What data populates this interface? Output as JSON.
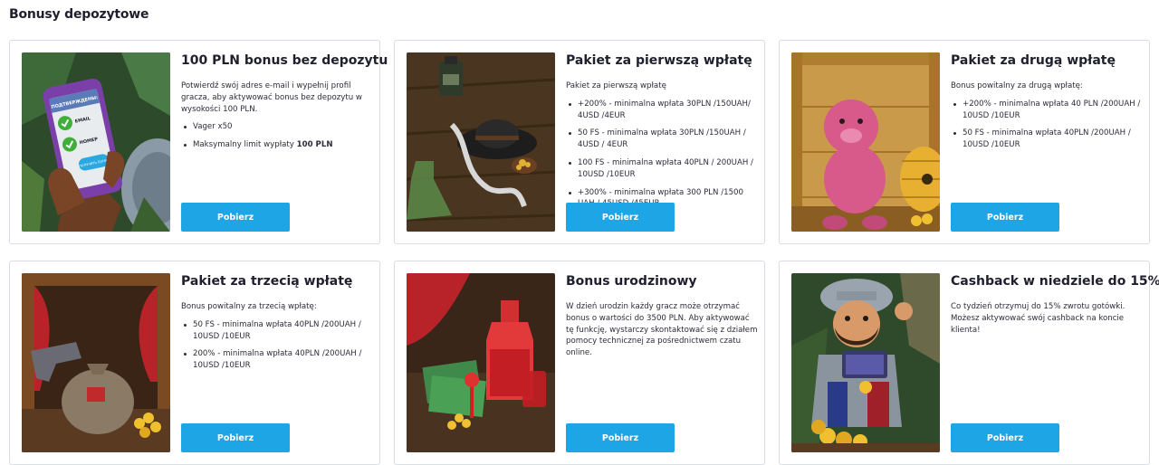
{
  "page": {
    "title": "Bonusy depozytowe"
  },
  "cards": [
    {
      "title": "100 PLN bonus bez depozytu",
      "intro": "Potwierdź swój adres e-mail i wypełnij profil gracza, aby aktywować bonus bez depozytu w wysokości 100 PLN.",
      "items": [
        "Vager x50",
        "Maksymalny limit wypłaty "
      ],
      "items_bold": [
        "",
        "100 PLN"
      ],
      "button": "Pobierz",
      "image": "phone-verification-illustration",
      "image_text": {
        "header": "ПОДТВЕРЖДЕНЫ:",
        "line1": "EMAIL",
        "line2": "НОМЕР",
        "cta": "ПОЛУЧИТЬ БОНУС"
      }
    },
    {
      "title": "Pakiet za pierwszą wpłatę",
      "intro": "Pakiet za pierwszą wpłatę",
      "items": [
        "+200% - minimalna wpłata 30PLN /150UAH/ 4USD /4EUR",
        "50 FS - minimalna wpłata 30PLN /150UAH / 4USD / 4EUR",
        "100 FS - minimalna wpłata 40PLN / 200UAH / 10USD /10EUR",
        "+300% - minimalna wpłata 300 PLN /1500 UAH / 45USD /45EUR"
      ],
      "button": "Pobierz",
      "image": "explorer-table-illustration"
    },
    {
      "title": "Pakiet za drugą wpłatę",
      "intro": "Bonus powitalny za drugą wpłatę:",
      "items": [
        "+200% - minimalna wpłata 40 PLN /200UAH / 10USD /10EUR",
        "50 FS - minimalna wpłata 40PLN /200UAH / 10USD /10EUR"
      ],
      "button": "Pobierz",
      "image": "pink-pig-beehive-illustration"
    },
    {
      "title": "Pakiet za trzecią wpłatę",
      "intro": "Bonus powitalny za trzecią wpłatę:",
      "items": [
        "50 FS - minimalna wpłata 40PLN /200UAH / 10USD /10EUR",
        "200% - minimalna wpłata 40PLN /200UAH / 10USD /10EUR"
      ],
      "button": "Pobierz",
      "image": "money-bag-revolver-illustration"
    },
    {
      "title": "Bonus urodzinowy",
      "intro": "W dzień urodzin każdy gracz może otrzymać bonus o wartości do 3500 PLN. Aby aktywować tę funkcję, wystarczy skontaktować się z działem pomocy technicznej za pośrednictwem czatu online.",
      "items": [],
      "button": "Pobierz",
      "image": "bottle-cash-gift-illustration"
    },
    {
      "title": "Cashback w niedziele do 15%",
      "intro": "Co tydzień otrzymuj do 15% zwrotu gotówki. Możesz aktywować swój cashback na koncie klienta!",
      "items": [],
      "button": "Pobierz",
      "image": "conquistador-treasure-illustration"
    }
  ],
  "colors": {
    "accent": "#1ea5e6",
    "border": "#d9dce3",
    "text": "#1f1f2e"
  }
}
